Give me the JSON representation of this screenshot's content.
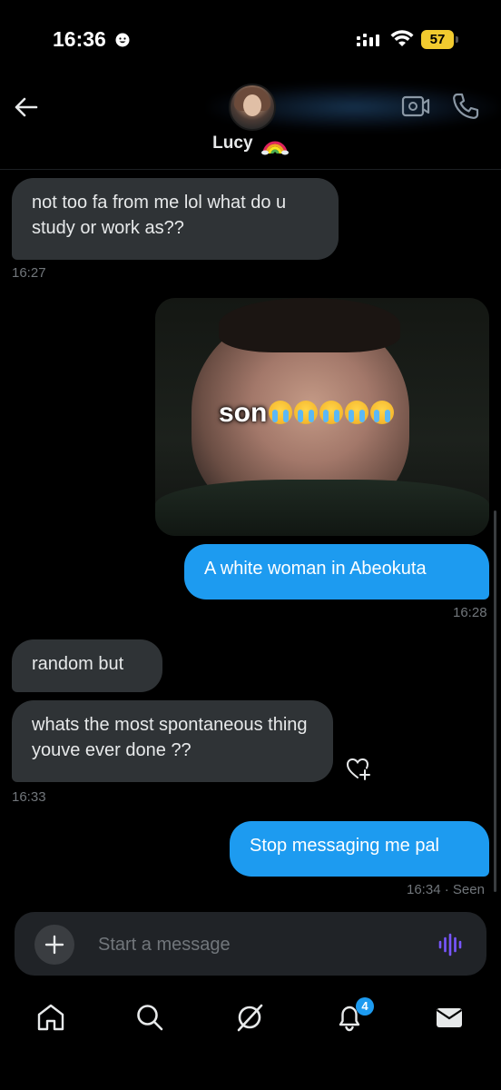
{
  "status_bar": {
    "time": "16:36",
    "battery": "57"
  },
  "header": {
    "contact_name": "Lucy",
    "back_icon": "arrow-left-icon",
    "video_icon": "video-camera-icon",
    "phone_icon": "phone-icon"
  },
  "messages": [
    {
      "type": "incoming",
      "text": "not too fa from me lol what do u study or work as??",
      "time": "16:27"
    },
    {
      "type": "outgoing-image",
      "caption": "son"
    },
    {
      "type": "outgoing",
      "text": "A white woman in Abeokuta",
      "time": "16:28"
    },
    {
      "type": "incoming",
      "text": "random but"
    },
    {
      "type": "incoming",
      "text": "whats the most spontaneous thing youve ever done ??",
      "time": "16:33"
    },
    {
      "type": "outgoing",
      "text": "Stop messaging me pal",
      "time": "16:34",
      "status": "· Seen"
    }
  ],
  "composer": {
    "placeholder": "Start a message"
  },
  "nav": {
    "notifications_badge": "4"
  },
  "colors": {
    "accent": "#1d9bf0",
    "incoming_bubble": "#2f3336",
    "background": "#000000",
    "muted_text": "#71767b",
    "voice_icon": "#7856ff"
  }
}
